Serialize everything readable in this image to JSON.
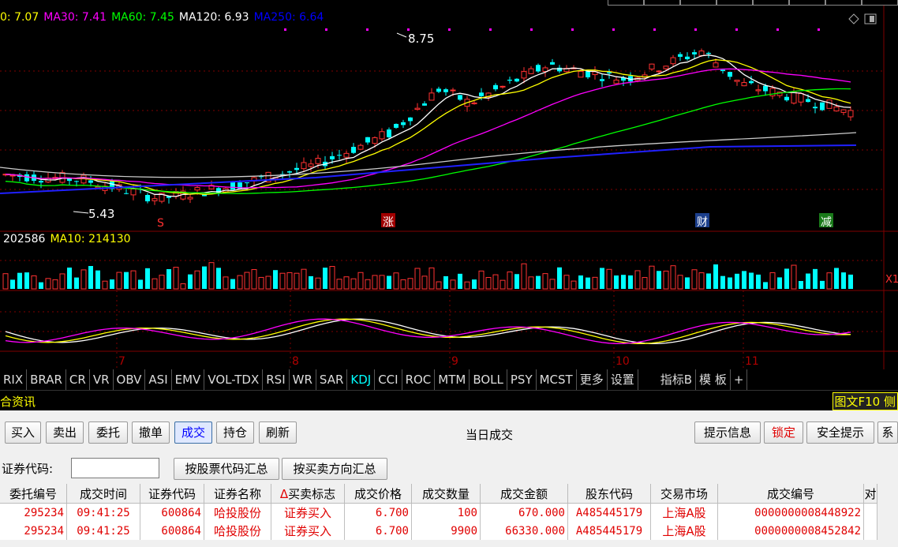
{
  "chart": {
    "ma_legend": [
      {
        "label": "0: 7.07",
        "color": "#ffff00"
      },
      {
        "label": "MA30: 7.41",
        "color": "#ff00ff"
      },
      {
        "label": "MA60: 7.45",
        "color": "#00ff00"
      },
      {
        "label": "MA120: 6.93",
        "color": "#ffffff"
      },
      {
        "label": "MA250: 6.64",
        "color": "#0000ff"
      }
    ],
    "high_label": "8.75",
    "low_label": "5.43",
    "event_markers": [
      "S",
      "涨",
      "财",
      "减"
    ],
    "volume_legend": {
      "vol": "202586",
      "ma10": "MA10: 214130"
    },
    "month_labels": [
      "7",
      "8",
      "9",
      "10",
      "11"
    ],
    "side_tag": "X1"
  },
  "indicator_tabs": [
    "RIX",
    "BRAR",
    "CR",
    "VR",
    "OBV",
    "ASI",
    "EMV",
    "VOL-TDX",
    "RSI",
    "WR",
    "SAR",
    "KDJ",
    "CCI",
    "ROC",
    "MTM",
    "BOLL",
    "PSY",
    "MCST",
    "更多",
    "设置",
    "指标B",
    "模 板",
    "+"
  ],
  "active_indicator": "KDJ",
  "news_bar": {
    "left": "合资讯",
    "right": "图文F10 侧"
  },
  "toolbar": {
    "buttons": [
      "买入",
      "卖出",
      "委托",
      "撤单",
      "成交",
      "持仓",
      "刷新"
    ],
    "active": "成交",
    "title": "当日成交",
    "right_buttons": [
      "提示信息",
      "锁定",
      "安全提示",
      "系"
    ]
  },
  "filter": {
    "code_label": "证券代码:",
    "code_value": "",
    "by_stock_button": "按股票代码汇总",
    "by_direction_button": "按买卖方向汇总"
  },
  "table": {
    "columns": [
      "委托编号",
      "成交时间",
      "证券代码",
      "证券名称",
      "买卖标志",
      "成交价格",
      "成交数量",
      "成交金额",
      "股东代码",
      "交易市场",
      "成交编号",
      "对"
    ],
    "rows": [
      [
        "295234",
        "09:41:25",
        "600864",
        "哈投股份",
        "证券买入",
        "6.700",
        "100",
        "670.000",
        "A485445179",
        "上海A股",
        "0000000008448922",
        ""
      ],
      [
        "295234",
        "09:41:25",
        "600864",
        "哈投股份",
        "证券买入",
        "6.700",
        "9900",
        "66330.000",
        "A485445179",
        "上海A股",
        "0000000008452842",
        ""
      ]
    ]
  },
  "colors": {
    "up": "#ff3232",
    "down": "#00ffff",
    "accent": "#e00000"
  }
}
